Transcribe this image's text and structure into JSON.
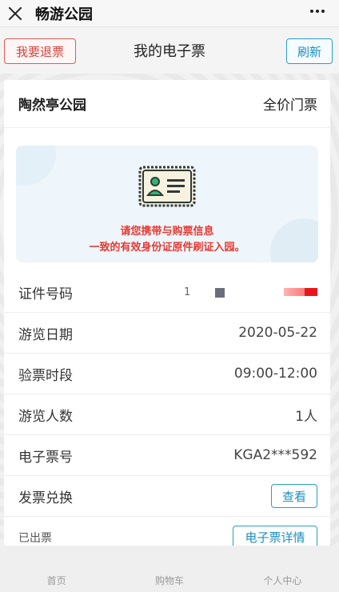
{
  "topbar": {
    "title": "畅游公园",
    "close_icon": "close-icon",
    "more_icon": "more-dots-icon"
  },
  "header": {
    "refund_label": "我要退票",
    "page_title": "我的电子票",
    "refresh_label": "刷新"
  },
  "ticket": {
    "park_name": "陶然亭公园",
    "ticket_type": "全价门票",
    "notice_icon": "id-card-icon",
    "notice_line1": "请您携带与购票信息",
    "notice_line2": "一致的有效身份证原件刷证入园。",
    "rows": [
      {
        "label": "证件号码",
        "value": "1"
      },
      {
        "label": "游览日期",
        "value": "2020-05-22"
      },
      {
        "label": "验票时段",
        "value": "09:00-12:00"
      },
      {
        "label": "游览人数",
        "value": "1人"
      },
      {
        "label": "电子票号",
        "value": "KGA2***592"
      },
      {
        "label": "发票兑换",
        "button": "查看"
      }
    ],
    "status_label": "已出票",
    "detail_button": "电子票详情"
  },
  "tabbar": {
    "tabs": [
      {
        "label": "首页"
      },
      {
        "label": "购物车"
      },
      {
        "label": "个人中心"
      }
    ]
  },
  "colors": {
    "refund_red": "#d9433c",
    "accent_blue": "#1d8fbf",
    "notice_red": "#e53a33",
    "notice_bg": "#eef6fb"
  }
}
